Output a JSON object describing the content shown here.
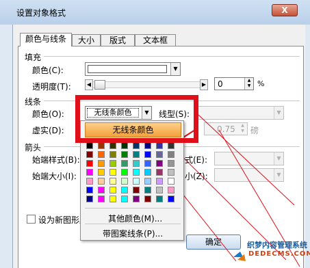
{
  "window": {
    "title": "设置对象格式",
    "close_label": "X"
  },
  "tabs": [
    "颜色与线条",
    "大小",
    "版式",
    "文本框"
  ],
  "fill": {
    "section_label": "填充",
    "color_label": "颜色(C):",
    "transparency_label": "透明度(T):",
    "transparency_value": "0",
    "transparency_unit": "%"
  },
  "line": {
    "section_label": "线条",
    "color_label": "颜色(O):",
    "color_value": "无线条颜色",
    "style_label": "线型(S):",
    "dash_label": "虚实(D):",
    "weight_value": "0.75",
    "weight_unit": "磅"
  },
  "arrows": {
    "section_label": "箭头",
    "start_style_label": "始端样式(B):",
    "start_size_label": "始端大小(I):",
    "partial_style_label": "式(E):",
    "partial_size_label": "小(Z):"
  },
  "popup": {
    "no_line_label": "无线条颜色",
    "more_colors_label": "其他颜色(M)...",
    "pattern_line_label": "带图案线条(P)..."
  },
  "default_checkbox_label": "设为新图形默",
  "ok_label": "确定",
  "watermark": {
    "brand": "织梦内容管理系统",
    "url": "DEDECMS.COM"
  },
  "palette": [
    [
      "#000000",
      "#993300",
      "#333300",
      "#003300",
      "#003366",
      "#000080",
      "#333399",
      "#333333"
    ],
    [
      "#800000",
      "#FF6600",
      "#808000",
      "#008000",
      "#008080",
      "#0000FF",
      "#666699",
      "#808080"
    ],
    [
      "#FF0000",
      "#FF9900",
      "#99CC00",
      "#339966",
      "#33CCCC",
      "#3366FF",
      "#800080",
      "#969696"
    ],
    [
      "#FF00FF",
      "#FFCC00",
      "#FFFF00",
      "#00FF00",
      "#00FFFF",
      "#00CCFF",
      "#993366",
      "#C0C0C0"
    ],
    [
      "#FF99CC",
      "#FFCC99",
      "#FFFF99",
      "#CCFFCC",
      "#CCFFFF",
      "#99CCFF",
      "#CC99FF",
      "#FFFFFF"
    ],
    [
      "#0000FF",
      "#FF00FF",
      "#FFFF00",
      "#00FFFF",
      "#800000",
      "#008080",
      "#C0C0C0",
      "#FF99CC"
    ],
    [
      "#000080",
      "#FF00FF",
      "#FFFF00",
      "#00FFFF",
      "#800080",
      "#800000",
      "#008080",
      "#0000FF"
    ]
  ],
  "colors": {
    "highlight": "#e0101a",
    "accent": "#f4a03a",
    "window_bg": "#dfe9f4"
  }
}
